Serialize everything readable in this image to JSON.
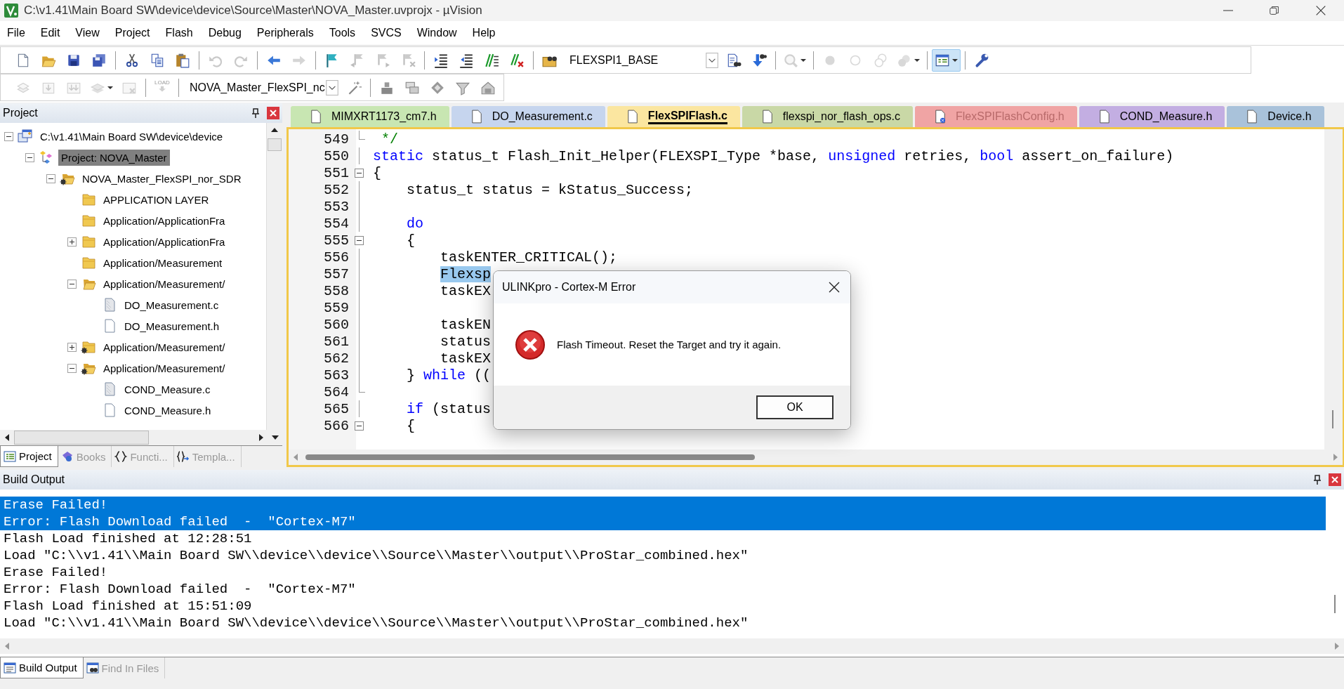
{
  "window": {
    "title": "C:\\v1.41\\Main Board SW\\device\\device\\Source\\Master\\NOVA_Master.uvprojx - µVision"
  },
  "menu": [
    "File",
    "Edit",
    "View",
    "Project",
    "Flash",
    "Debug",
    "Peripherals",
    "Tools",
    "SVCS",
    "Window",
    "Help"
  ],
  "toolbar_1": [
    {
      "kind": "button",
      "disabled": false,
      "pressed": false
    },
    {
      "kind": "button",
      "disabled": false,
      "pressed": false
    },
    {
      "kind": "button",
      "disabled": false,
      "pressed": false
    },
    {
      "kind": "button",
      "disabled": false,
      "pressed": false
    },
    {
      "kind": "separator"
    },
    {
      "kind": "button",
      "disabled": false,
      "pressed": false
    },
    {
      "kind": "button",
      "disabled": false,
      "pressed": false
    },
    {
      "kind": "button",
      "disabled": false,
      "pressed": false
    },
    {
      "kind": "separator"
    },
    {
      "kind": "button",
      "disabled": true,
      "pressed": false
    },
    {
      "kind": "button",
      "disabled": true,
      "pressed": false
    },
    {
      "kind": "separator"
    },
    {
      "kind": "button",
      "disabled": false,
      "pressed": false
    },
    {
      "kind": "button",
      "disabled": true,
      "pressed": false
    },
    {
      "kind": "separator"
    },
    {
      "kind": "button",
      "disabled": false,
      "pressed": false
    },
    {
      "kind": "button",
      "disabled": true,
      "pressed": false
    },
    {
      "kind": "button",
      "disabled": true,
      "pressed": false
    },
    {
      "kind": "button",
      "disabled": true,
      "pressed": false
    },
    {
      "kind": "separator"
    },
    {
      "kind": "button",
      "disabled": false,
      "pressed": false
    },
    {
      "kind": "button",
      "disabled": false,
      "pressed": false
    },
    {
      "kind": "button",
      "disabled": false,
      "pressed": false
    },
    {
      "kind": "button",
      "disabled": false,
      "pressed": false
    },
    {
      "kind": "separator"
    },
    {
      "kind": "button",
      "disabled": false,
      "pressed": false
    },
    {
      "kind": "combo",
      "value": "FLEXSPI1_BASE"
    },
    {
      "kind": "button",
      "disabled": false,
      "pressed": false
    },
    {
      "kind": "button",
      "disabled": false,
      "pressed": false
    },
    {
      "kind": "separator"
    },
    {
      "kind": "split",
      "disabled": true,
      "pressed": false
    },
    {
      "kind": "separator"
    },
    {
      "kind": "button",
      "disabled": true,
      "pressed": false
    },
    {
      "kind": "button",
      "disabled": true,
      "pressed": false
    },
    {
      "kind": "button",
      "disabled": true,
      "pressed": false
    },
    {
      "kind": "split",
      "disabled": true,
      "pressed": false
    },
    {
      "kind": "separator"
    },
    {
      "kind": "split",
      "disabled": false,
      "pressed": true
    },
    {
      "kind": "separator"
    },
    {
      "kind": "button",
      "disabled": false,
      "pressed": false
    }
  ],
  "toolbar_2": [
    {
      "kind": "button",
      "disabled": true,
      "pressed": false
    },
    {
      "kind": "button",
      "disabled": true,
      "pressed": false
    },
    {
      "kind": "button",
      "disabled": true,
      "pressed": false
    },
    {
      "kind": "split",
      "disabled": true,
      "pressed": false
    },
    {
      "kind": "button",
      "disabled": true,
      "pressed": false
    },
    {
      "kind": "separator"
    },
    {
      "kind": "button",
      "disabled": true,
      "pressed": false,
      "label": "LOAD"
    },
    {
      "kind": "separator"
    },
    {
      "kind": "combo",
      "value": "NOVA_Master_FlexSPI_nc"
    },
    {
      "kind": "button",
      "disabled": false,
      "pressed": false
    },
    {
      "kind": "separator"
    },
    {
      "kind": "button",
      "disabled": false,
      "pressed": false
    },
    {
      "kind": "button",
      "disabled": false,
      "pressed": false
    },
    {
      "kind": "button",
      "disabled": false,
      "pressed": false
    },
    {
      "kind": "button",
      "disabled": false,
      "pressed": false
    },
    {
      "kind": "button",
      "disabled": false,
      "pressed": false
    }
  ],
  "project_panel": {
    "title": "Project",
    "tree": [
      {
        "label": "C:\\v1.41\\Main Board SW\\device\\device",
        "kind": "workspace",
        "expanded": true,
        "selected": false,
        "children": [
          {
            "label": "Project: NOVA_Master",
            "kind": "project",
            "expanded": true,
            "selected": true,
            "children": [
              {
                "label": "NOVA_Master_FlexSPI_nor_SDR",
                "kind": "target",
                "expanded": true,
                "selected": false,
                "children": [
                  {
                    "label": "APPLICATION LAYER",
                    "kind": "folder",
                    "gear": false,
                    "selected": false
                  },
                  {
                    "label": "Application/ApplicationFra",
                    "kind": "folder",
                    "gear": false,
                    "selected": false
                  },
                  {
                    "label": "Application/ApplicationFra",
                    "kind": "folder",
                    "gear": false,
                    "expanded": false,
                    "selected": false
                  },
                  {
                    "label": "Application/Measurement",
                    "kind": "folder",
                    "gear": false,
                    "selected": false
                  },
                  {
                    "label": "Application/Measurement/",
                    "kind": "folder",
                    "gear": false,
                    "expanded": true,
                    "selected": false,
                    "children": [
                      {
                        "label": "DO_Measurement.c",
                        "kind": "file",
                        "shaded": true,
                        "selected": false
                      },
                      {
                        "label": "DO_Measurement.h",
                        "kind": "file",
                        "shaded": false,
                        "selected": false
                      }
                    ]
                  },
                  {
                    "label": "Application/Measurement/",
                    "kind": "folder",
                    "gear": true,
                    "expanded": false,
                    "selected": false
                  },
                  {
                    "label": "Application/Measurement/",
                    "kind": "folder",
                    "gear": true,
                    "expanded": true,
                    "selected": false,
                    "children": [
                      {
                        "label": "COND_Measure.c",
                        "kind": "file",
                        "shaded": true,
                        "selected": false
                      },
                      {
                        "label": "COND_Measure.h",
                        "kind": "file",
                        "shaded": false,
                        "selected": false
                      }
                    ]
                  }
                ]
              }
            ]
          }
        ]
      }
    ],
    "tabs": [
      {
        "label": "Project",
        "selected": true
      },
      {
        "label": "Books",
        "selected": false
      },
      {
        "label": "Functi...",
        "selected": false
      },
      {
        "label": "Templa...",
        "selected": false
      }
    ]
  },
  "editor": {
    "tabs": [
      {
        "label": "MIMXRT1173_cm7.h",
        "color": "#c8e6b2",
        "selected": false,
        "badged": false
      },
      {
        "label": "DO_Measurement.c",
        "color": "#c6d5ee",
        "selected": false,
        "badged": false
      },
      {
        "label": "FlexSPIFlash.c",
        "color": "#fbe6a0",
        "selected": true,
        "badged": false
      },
      {
        "label": "flexspi_nor_flash_ops.c",
        "color": "#c9d8a6",
        "selected": false,
        "badged": false
      },
      {
        "label": "FlexSPIFlashConfig.h",
        "color": "#f0a4a4",
        "selected": false,
        "badged": true
      },
      {
        "label": "COND_Measure.h",
        "color": "#c3aee2",
        "selected": false,
        "badged": false
      },
      {
        "label": "Device.h",
        "color": "#a9c2da",
        "selected": false,
        "badged": false
      }
    ],
    "lines": [
      {
        "number": "549",
        "fold_open": false,
        "fold_end": true,
        "segments": [
          {
            "text": " */",
            "kind": "comment"
          }
        ]
      },
      {
        "number": "550",
        "fold_open": false,
        "fold_end": false,
        "segments": [
          {
            "text": "static",
            "kind": "keyword"
          },
          {
            "text": " status_t Flash_Init_Helper(FLEXSPI_Type *base, ",
            "kind": "plain"
          },
          {
            "text": "unsigned",
            "kind": "keyword"
          },
          {
            "text": " retries, ",
            "kind": "plain"
          },
          {
            "text": "bool",
            "kind": "keyword"
          },
          {
            "text": " assert_on_failure)",
            "kind": "plain"
          }
        ]
      },
      {
        "number": "551",
        "fold_open": true,
        "fold_end": false,
        "segments": [
          {
            "text": "{",
            "kind": "plain"
          }
        ]
      },
      {
        "number": "552",
        "fold_open": false,
        "fold_end": false,
        "segments": [
          {
            "text": "    status_t status = kStatus_Success;",
            "kind": "plain"
          }
        ]
      },
      {
        "number": "553",
        "fold_open": false,
        "fold_end": false
      },
      {
        "number": "554",
        "fold_open": false,
        "fold_end": false,
        "segments": [
          {
            "text": "    do",
            "kind": "keyword"
          }
        ]
      },
      {
        "number": "555",
        "fold_open": true,
        "fold_end": false,
        "segments": [
          {
            "text": "    {",
            "kind": "plain"
          }
        ]
      },
      {
        "number": "556",
        "fold_open": false,
        "fold_end": false,
        "segments": [
          {
            "text": "        taskENTER_CRITICAL();",
            "kind": "plain"
          }
        ]
      },
      {
        "number": "557",
        "fold_open": false,
        "fold_end": false,
        "segments": [
          {
            "text": "        Flexsp",
            "kind": "selected"
          }
        ]
      },
      {
        "number": "558",
        "fold_open": false,
        "fold_end": false,
        "segments": [
          {
            "text": "        taskEX",
            "kind": "plain"
          }
        ]
      },
      {
        "number": "559",
        "fold_open": false,
        "fold_end": false
      },
      {
        "number": "560",
        "fold_open": false,
        "fold_end": false,
        "segments": [
          {
            "text": "        taskEN",
            "kind": "plain"
          }
        ]
      },
      {
        "number": "561",
        "fold_open": false,
        "fold_end": false,
        "segments": [
          {
            "text": "        status",
            "kind": "plain"
          }
        ]
      },
      {
        "number": "562",
        "fold_open": false,
        "fold_end": false,
        "segments": [
          {
            "text": "        taskEX",
            "kind": "plain"
          }
        ]
      },
      {
        "number": "563",
        "fold_open": false,
        "fold_end": false,
        "segments": [
          {
            "text": "    } ",
            "kind": "plain"
          },
          {
            "text": "while",
            "kind": "keyword"
          },
          {
            "text": " ((",
            "kind": "plain"
          }
        ]
      },
      {
        "number": "564",
        "fold_open": false,
        "fold_end": true
      },
      {
        "number": "565",
        "fold_open": false,
        "fold_end": false,
        "segments": [
          {
            "text": "    if",
            "kind": "keyword"
          },
          {
            "text": " (status",
            "kind": "plain"
          }
        ]
      },
      {
        "number": "566",
        "fold_open": true,
        "fold_end": false,
        "segments": [
          {
            "text": "    {",
            "kind": "plain"
          }
        ]
      }
    ]
  },
  "build_output": {
    "title": "Build Output",
    "lines": [
      {
        "text": "Erase Failed!",
        "selected": true
      },
      {
        "text": "Error: Flash Download failed  -  \"Cortex-M7\"",
        "selected": true
      },
      {
        "text": "Flash Load finished at 12:28:51",
        "selected": false
      },
      {
        "text": "Load \"C:\\\\v1.41\\\\Main Board SW\\\\device\\\\device\\\\Source\\\\Master\\\\output\\\\ProStar_combined.hex\"",
        "selected": false
      },
      {
        "text": "Erase Failed!",
        "selected": false
      },
      {
        "text": "Error: Flash Download failed  -  \"Cortex-M7\"",
        "selected": false
      },
      {
        "text": "Flash Load finished at 15:51:09",
        "selected": false
      },
      {
        "text": "Load \"C:\\\\v1.41\\\\Main Board SW\\\\device\\\\device\\\\Source\\\\Master\\\\output\\\\ProStar_combined.hex\"",
        "selected": false
      }
    ],
    "tabs": [
      {
        "label": "Build Output",
        "selected": true
      },
      {
        "label": "Find In Files",
        "selected": false
      }
    ]
  },
  "dialog": {
    "title": "ULINKpro - Cortex-M Error",
    "message": "Flash Timeout. Reset the Target and try it again.",
    "button": "OK"
  }
}
